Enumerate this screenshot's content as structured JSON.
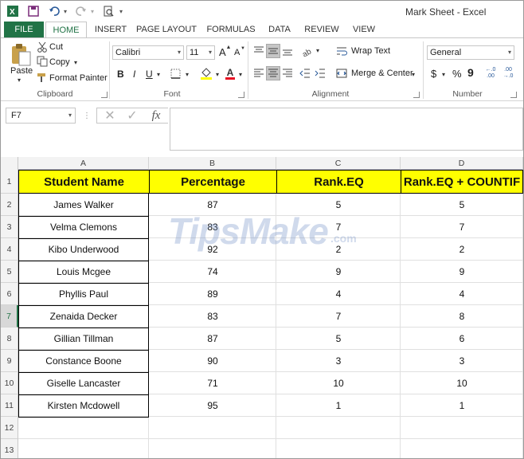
{
  "window": {
    "title": "Mark Sheet - Excel",
    "accent": "#217346"
  },
  "quick_access": {
    "excel_icon": "excel-logo-icon",
    "save_icon": "save-icon",
    "undo_icon": "undo-icon",
    "redo_icon": "redo-icon",
    "preview_icon": "print-preview-icon"
  },
  "tabs": [
    {
      "label": "FILE"
    },
    {
      "label": "HOME"
    },
    {
      "label": "INSERT"
    },
    {
      "label": "PAGE LAYOUT"
    },
    {
      "label": "FORMULAS"
    },
    {
      "label": "DATA"
    },
    {
      "label": "REVIEW"
    },
    {
      "label": "VIEW"
    }
  ],
  "ribbon": {
    "clipboard": {
      "paste": "Paste",
      "cut": "Cut",
      "copy": "Copy",
      "format_painter": "Format Painter",
      "label": "Clipboard"
    },
    "font": {
      "font_name": "Calibri",
      "font_size": "11",
      "bold": "B",
      "italic": "I",
      "underline": "U",
      "grow": "A",
      "shrink": "A",
      "color_letter": "A",
      "label": "Font",
      "fill_color": "#ffff00",
      "font_color": "#e81123"
    },
    "alignment": {
      "wrap_text": "Wrap Text",
      "merge_center": "Merge & Center",
      "label": "Alignment"
    },
    "number": {
      "format": "General",
      "currency": "$",
      "percent": "%",
      "comma": "9",
      "inc_decimal": "←.0\n.00",
      "dec_decimal": ".00\n→.0",
      "label": "Number"
    }
  },
  "formula_bar": {
    "name_box": "F7",
    "cancel": "✕",
    "enter": "✓",
    "fx": "fx",
    "value": ""
  },
  "sheet": {
    "columns": [
      "A",
      "B",
      "C",
      "D"
    ],
    "headers": [
      "Student Name",
      "Percentage",
      "Rank.EQ",
      "Rank.EQ + COUNTIF"
    ],
    "rows": [
      {
        "row": "2",
        "name": "James Walker",
        "pct": "87",
        "rank": "5",
        "rank2": "5"
      },
      {
        "row": "3",
        "name": "Velma Clemons",
        "pct": "83",
        "rank": "7",
        "rank2": "7"
      },
      {
        "row": "4",
        "name": "Kibo Underwood",
        "pct": "92",
        "rank": "2",
        "rank2": "2"
      },
      {
        "row": "5",
        "name": "Louis Mcgee",
        "pct": "74",
        "rank": "9",
        "rank2": "9"
      },
      {
        "row": "6",
        "name": "Phyllis Paul",
        "pct": "89",
        "rank": "4",
        "rank2": "4"
      },
      {
        "row": "7",
        "name": "Zenaida Decker",
        "pct": "83",
        "rank": "7",
        "rank2": "8"
      },
      {
        "row": "8",
        "name": "Gillian Tillman",
        "pct": "87",
        "rank": "5",
        "rank2": "6"
      },
      {
        "row": "9",
        "name": "Constance Boone",
        "pct": "90",
        "rank": "3",
        "rank2": "3"
      },
      {
        "row": "10",
        "name": "Giselle Lancaster",
        "pct": "71",
        "rank": "10",
        "rank2": "10"
      },
      {
        "row": "11",
        "name": "Kirsten Mcdowell",
        "pct": "95",
        "rank": "1",
        "rank2": "1"
      }
    ],
    "row_numbers": [
      "1",
      "2",
      "3",
      "4",
      "5",
      "6",
      "7",
      "8",
      "9",
      "10",
      "11",
      "12",
      "13"
    ],
    "header_fill": "#ffff00",
    "selected_row": "7"
  },
  "watermark": {
    "text": "TipsMake",
    "suffix": ".com"
  }
}
